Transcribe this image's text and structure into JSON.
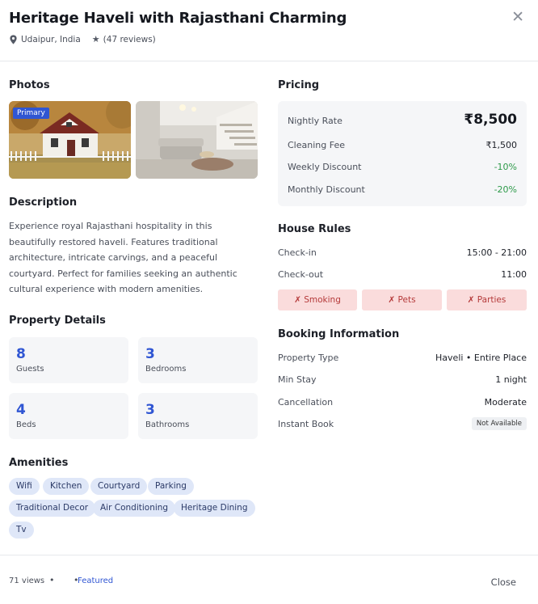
{
  "listing": {
    "title": "Heritage Haveli with Rajasthani Charming",
    "location": "Udaipur, India",
    "reviews": "(47 reviews)"
  },
  "photos": {
    "section_title": "Photos",
    "primary_label": "Primary"
  },
  "description": {
    "section_title": "Description",
    "text": "Experience royal Rajasthani hospitality in this beautifully restored haveli. Features traditional architecture, intricate carvings, and a peaceful courtyard. Perfect for families seeking an authentic cultural experience with modern amenities."
  },
  "property_details": {
    "section_title": "Property Details",
    "stats": [
      {
        "value": "8",
        "label": "Guests"
      },
      {
        "value": "3",
        "label": "Bedrooms"
      },
      {
        "value": "4",
        "label": "Beds"
      },
      {
        "value": "3",
        "label": "Bathrooms"
      }
    ]
  },
  "amenities": {
    "section_title": "Amenities",
    "items": [
      "Wifi",
      "Kitchen",
      "Courtyard",
      "Parking",
      "Traditional Decor",
      "Air Conditioning",
      "Heritage Dining",
      "Tv"
    ]
  },
  "pricing": {
    "section_title": "Pricing",
    "nightly_label": "Nightly Rate",
    "nightly_value": "₹8,500",
    "cleaning_label": "Cleaning Fee",
    "cleaning_value": "₹1,500",
    "weekly_label": "Weekly Discount",
    "weekly_value": "-10%",
    "monthly_label": "Monthly Discount",
    "monthly_value": "-20%"
  },
  "house_rules": {
    "section_title": "House Rules",
    "checkin_label": "Check-in",
    "checkin_value": "15:00 - 21:00",
    "checkout_label": "Check-out",
    "checkout_value": "11:00",
    "restrictions": [
      "✗ Smoking",
      "✗ Pets",
      "✗ Parties"
    ]
  },
  "booking": {
    "section_title": "Booking Information",
    "property_type_label": "Property Type",
    "property_type_value": "Haveli • Entire Place",
    "min_stay_label": "Min Stay",
    "min_stay_value": "1 night",
    "cancellation_label": "Cancellation",
    "cancellation_value": "Moderate",
    "instant_label": "Instant Book",
    "instant_value": "Not Available"
  },
  "footer": {
    "views": "71 views",
    "dots": "• •",
    "featured": "Featured",
    "close_label": "Close"
  },
  "icons": {
    "close": "close-icon",
    "location": "map-pin-icon",
    "rating": "star-icon"
  },
  "colors": {
    "accent": "#3056d3",
    "positive": "#2e9a4a",
    "restriction_bg": "#fadcdc",
    "restriction_text": "#b53a3a",
    "chip_bg": "#dfe7f8"
  }
}
